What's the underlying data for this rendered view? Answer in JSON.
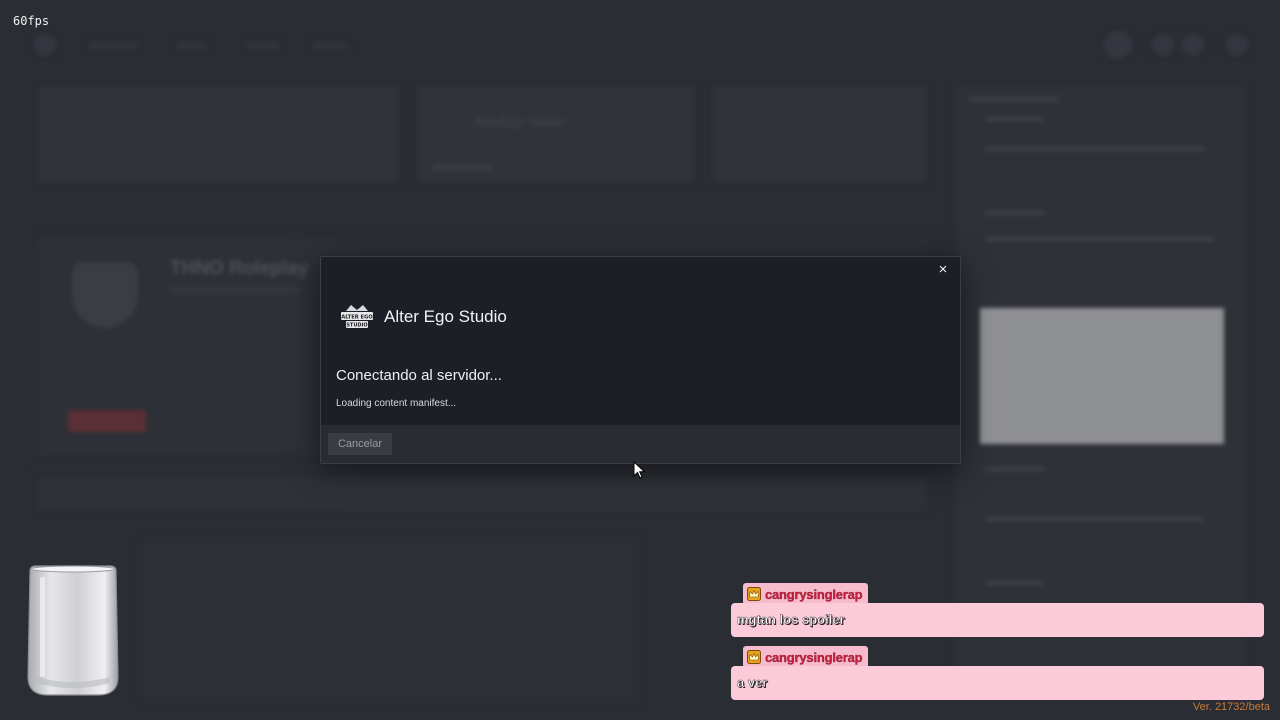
{
  "overlay": {
    "fps": "60fps",
    "version": "Ver. 21732/beta"
  },
  "background": {
    "server_title": "THNO Roleplay",
    "tile_title": "AlterEgo Studio"
  },
  "modal": {
    "brand_name": "Alter Ego Studio",
    "logo_text_top": "ALTER EGO",
    "logo_text_bottom": "STUDIO",
    "title": "Conectando al servidor...",
    "status": "Loading content manifest...",
    "cancel_label": "Cancelar",
    "close_icon": "×"
  },
  "chat": {
    "messages": [
      {
        "user": "cangrysinglerap",
        "text": "mgtan los spoiler"
      },
      {
        "user": "cangrysinglerap",
        "text": "a ver"
      }
    ]
  },
  "colors": {
    "accent_pink": "#fccbda",
    "version_orange": "#c87a3a"
  }
}
